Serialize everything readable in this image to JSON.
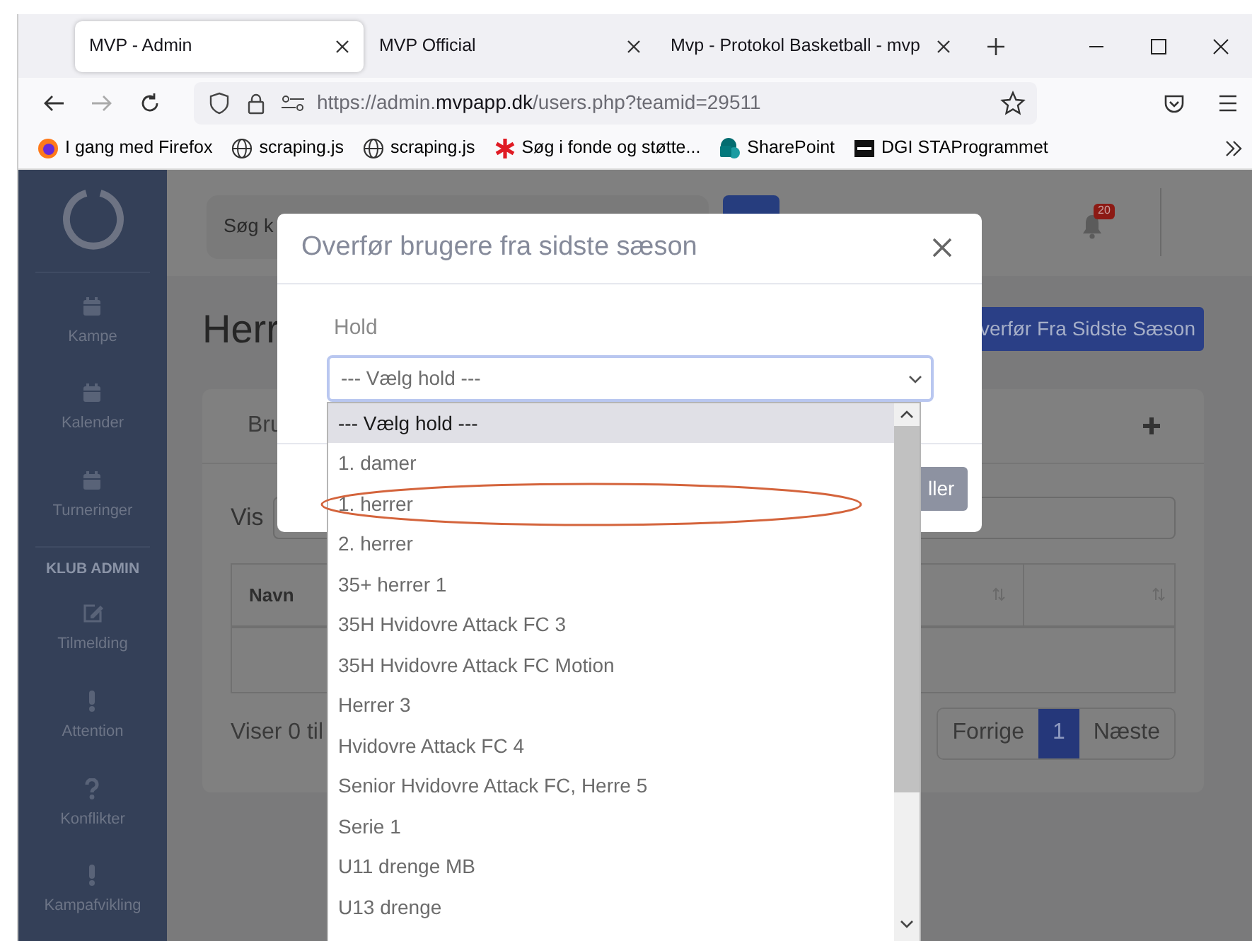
{
  "browser": {
    "tabs": [
      {
        "title": "MVP - Admin",
        "selected": true
      },
      {
        "title": "MVP Official",
        "selected": false
      },
      {
        "title": "Mvp - Protokol Basketball - mvp",
        "selected": false
      }
    ],
    "url": {
      "host_start": "https://admin.",
      "domain": "mvpapp.dk",
      "path": "/users.php?teamid=29511"
    },
    "bookmarks": [
      {
        "kind": "firefox",
        "label": "I gang med Firefox"
      },
      {
        "kind": "globe",
        "label": "scraping.js"
      },
      {
        "kind": "globe",
        "label": "scraping.js"
      },
      {
        "kind": "asterisk",
        "label": "Søg i fonde og støtte..."
      },
      {
        "kind": "sharepoint",
        "label": "SharePoint"
      },
      {
        "kind": "square",
        "label": "DGI STAProgrammet"
      }
    ]
  },
  "sidebar": {
    "top_items": [
      {
        "label": "Kampe",
        "kind": "calendar"
      },
      {
        "label": "Kalender",
        "kind": "calendar"
      },
      {
        "label": "Turneringer",
        "kind": "calendar"
      }
    ],
    "section_label": "KLUB ADMIN",
    "admin_items": [
      {
        "label": "Tilmelding",
        "kind": "edit"
      },
      {
        "label": "Attention",
        "kind": "exclamation"
      },
      {
        "label": "Konflikter",
        "kind": "question"
      },
      {
        "label": "Kampafvikling",
        "kind": "exclamation"
      }
    ]
  },
  "page": {
    "search": {
      "placeholder": "Søg k"
    },
    "notification_count": "20",
    "heading": "Herr",
    "transfer_button": "verfør Fra Sidste Sæson",
    "card_tab": "Bru",
    "show_label": "Vis",
    "table": {
      "columns": [
        "Navn"
      ]
    },
    "info": "Viser 0 til",
    "pagination": [
      {
        "label": "Forrige",
        "selected": false
      },
      {
        "label": "1",
        "selected": true
      },
      {
        "label": "Næste",
        "selected": false
      }
    ]
  },
  "modal": {
    "title": "Overfør brugere fra sidste sæson",
    "field_label": "Hold",
    "select_value": "--- Vælg hold ---",
    "footer_button": "ller",
    "options": [
      {
        "label": "--- Vælg hold ---",
        "selected": true,
        "circled": false
      },
      {
        "label": "1. damer",
        "selected": false,
        "circled": false
      },
      {
        "label": "1. herrer",
        "selected": false,
        "circled": true
      },
      {
        "label": "2. herrer",
        "selected": false,
        "circled": false
      },
      {
        "label": "35+ herrer 1",
        "selected": false,
        "circled": false
      },
      {
        "label": "35H Hvidovre Attack FC 3",
        "selected": false,
        "circled": false
      },
      {
        "label": "35H Hvidovre Attack FC Motion",
        "selected": false,
        "circled": false
      },
      {
        "label": "Herrer 3",
        "selected": false,
        "circled": false
      },
      {
        "label": "Hvidovre Attack FC 4",
        "selected": false,
        "circled": false
      },
      {
        "label": "Senior Hvidovre Attack FC, Herre 5",
        "selected": false,
        "circled": false
      },
      {
        "label": "Serie 1",
        "selected": false,
        "circled": false
      },
      {
        "label": "U11 drenge MB",
        "selected": false,
        "circled": false
      },
      {
        "label": "U13 drenge",
        "selected": false,
        "circled": false
      }
    ]
  }
}
